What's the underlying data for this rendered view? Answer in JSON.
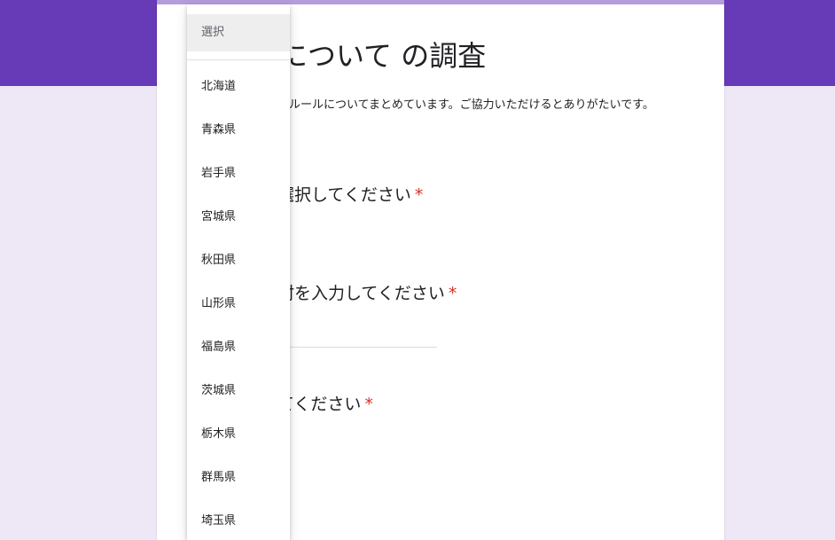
{
  "form": {
    "title": "について の調査",
    "description": "のルールについてまとめています。ご協力いただけるとありがたいです。",
    "questions": [
      {
        "label": "選択してください",
        "required_mark": "*"
      },
      {
        "label": "村を入力してください",
        "required_mark": "*"
      },
      {
        "label": "てください",
        "required_mark": "*"
      }
    ]
  },
  "dropdown": {
    "placeholder": "選択",
    "options": [
      {
        "label": "北海道"
      },
      {
        "label": "青森県"
      },
      {
        "label": "岩手県"
      },
      {
        "label": "宮城県"
      },
      {
        "label": "秋田県"
      },
      {
        "label": "山形県"
      },
      {
        "label": "福島県"
      },
      {
        "label": "茨城県"
      },
      {
        "label": "栃木県"
      },
      {
        "label": "群馬県"
      },
      {
        "label": "埼玉県"
      }
    ]
  },
  "colors": {
    "header_band": "#673ab7",
    "page_background": "#ede7f6",
    "card_top_border": "#b39ddb",
    "required": "#d93025"
  }
}
